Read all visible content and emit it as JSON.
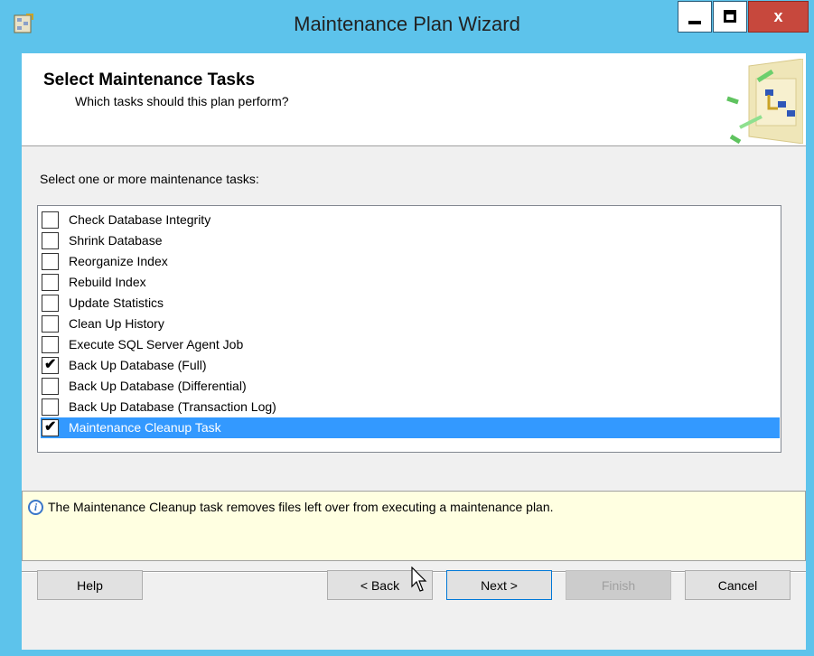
{
  "window": {
    "title": "Maintenance Plan Wizard",
    "close_label": "x"
  },
  "header": {
    "title": "Select Maintenance Tasks",
    "subtitle": "Which tasks should this plan perform?"
  },
  "prompt": "Select one or more maintenance tasks:",
  "tasks": [
    {
      "label": "Check Database Integrity",
      "checked": false
    },
    {
      "label": "Shrink Database",
      "checked": false
    },
    {
      "label": "Reorganize Index",
      "checked": false
    },
    {
      "label": "Rebuild Index",
      "checked": false
    },
    {
      "label": "Update Statistics",
      "checked": false
    },
    {
      "label": "Clean Up History",
      "checked": false
    },
    {
      "label": "Execute SQL Server Agent Job",
      "checked": false
    },
    {
      "label": "Back Up Database (Full)",
      "checked": true
    },
    {
      "label": "Back Up Database (Differential)",
      "checked": false
    },
    {
      "label": "Back Up Database (Transaction Log)",
      "checked": false
    },
    {
      "label": "Maintenance Cleanup Task",
      "checked": true,
      "selected": true
    }
  ],
  "info": {
    "text": "The Maintenance Cleanup task removes files left over from executing a maintenance plan."
  },
  "buttons": {
    "help": "Help",
    "back": "< Back",
    "next": "Next >",
    "finish": "Finish",
    "cancel": "Cancel"
  },
  "colors": {
    "title_bar": "#5dc3eb",
    "selection": "#3399ff",
    "close_button": "#c7483d",
    "info_background": "#ffffe1"
  }
}
